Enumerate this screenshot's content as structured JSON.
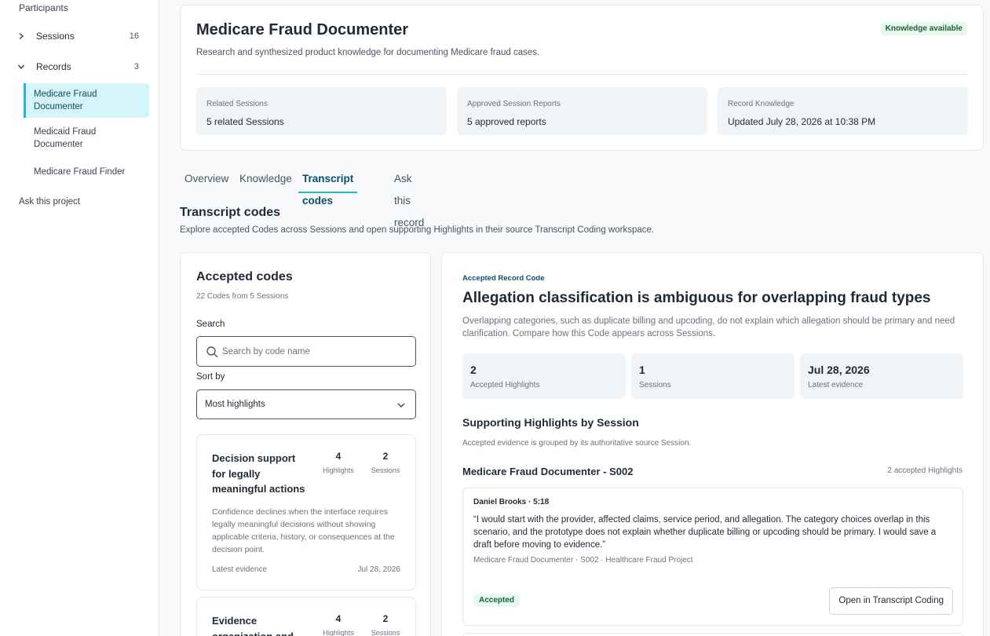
{
  "sidebar": {
    "participants_label": "Participants",
    "sessions": {
      "label": "Sessions",
      "count": "16"
    },
    "records": {
      "label": "Records",
      "count": "3"
    },
    "record_items": [
      {
        "label": "Medicare Fraud Documenter"
      },
      {
        "label": "Medicaid Fraud Documenter"
      },
      {
        "label": "Medicare Fraud Finder"
      }
    ],
    "ask_project": "Ask this project"
  },
  "header": {
    "title": "Medicare Fraud Documenter",
    "badge": "Knowledge available",
    "description": "Research and synthesized product knowledge for documenting Medicare fraud cases.",
    "stats": [
      {
        "label": "Related Sessions",
        "value": "5 related Sessions"
      },
      {
        "label": "Approved Session Reports",
        "value": "5 approved reports"
      },
      {
        "label": "Record Knowledge",
        "value": "Updated July 28, 2026 at 10:38 PM"
      }
    ]
  },
  "tabs": [
    {
      "label": "Overview"
    },
    {
      "label": "Knowledge"
    },
    {
      "label": "Transcript codes"
    },
    {
      "label": "Ask this record"
    }
  ],
  "section": {
    "title": "Transcript codes",
    "description": "Explore accepted Codes across Sessions and open supporting Highlights in their source Transcript Coding workspace."
  },
  "codes_panel": {
    "title": "Accepted codes",
    "subtitle": "22 Codes from 5 Sessions",
    "search_label": "Search",
    "search_placeholder": "Search by code name",
    "sort_label": "Sort by",
    "sort_value": "Most highlights",
    "cards": [
      {
        "name": "Decision support for legally meaningful actions",
        "highlights": "4",
        "highlights_label": "Highlights",
        "sessions": "2",
        "sessions_label": "Sessions",
        "description": "Confidence declines when the interface requires legally meaningful decisions without showing applicable criteria, history, or consequences at the decision point.",
        "latest_label": "Latest evidence",
        "latest_date": "Jul 28, 2026"
      },
      {
        "name": "Evidence organization and",
        "highlights": "4",
        "highlights_label": "Highlights",
        "sessions": "2",
        "sessions_label": "Sessions"
      }
    ]
  },
  "detail": {
    "kicker": "Accepted Record Code",
    "title": "Allegation classification is ambiguous for overlapping fraud types",
    "description": "Overlapping categories, such as duplicate billing and upcoding, do not explain which allegation should be primary and need clarification. Compare how this Code appears across Sessions.",
    "stats": [
      {
        "value": "2",
        "label": "Accepted Highlights"
      },
      {
        "value": "1",
        "label": "Sessions"
      },
      {
        "value": "Jul 28, 2026",
        "label": "Latest evidence"
      }
    ],
    "supporting_title": "Supporting Highlights by Session",
    "supporting_sub": "Accepted evidence is grouped by its authoritative source Session.",
    "session_name": "Medicare Fraud Documenter - S002",
    "session_count": "2 accepted Highlights",
    "highlight": {
      "speaker": "Daniel Brooks · 5:18",
      "quote": "“I would start with the provider, affected claims, service period, and allegation. The category choices overlap in this scenario, and the prototype does not explain whether duplicate billing or upcoding should be primary. I would save a draft before moving to evidence.”",
      "source": "Medicare Fraud Documenter - S002 · Healthcare Fraud Project",
      "status": "Accepted",
      "open_label": "Open in Transcript Coding"
    }
  }
}
